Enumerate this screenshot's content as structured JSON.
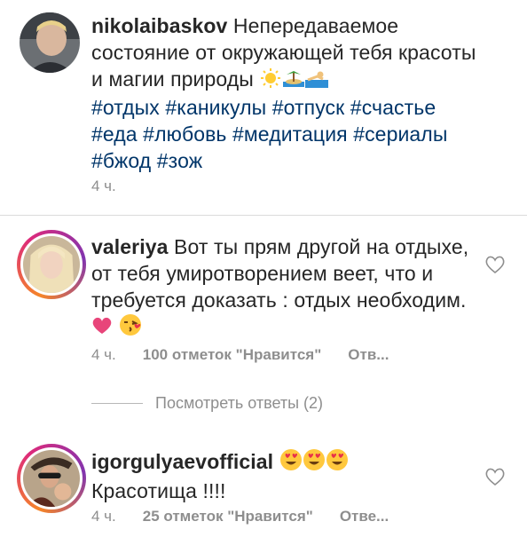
{
  "comments": [
    {
      "username": "nikolaibaskov",
      "text": "Непередаваемое состояние от окружающей тебя красоты и магии природы",
      "emoji_icons": [
        "sun-icon",
        "island-icon",
        "swimmer-icon"
      ],
      "hashtags": "#отдых #каникулы #отпуск  #счастье #еда #любовь #медитация #сериалы #бжод #зож",
      "time": "4 ч."
    },
    {
      "username": "valeriya",
      "text": "Вот ты прям другой на отдыхе, от тебя умиротворением веет, что и требуется доказать : отдых необходим.",
      "emoji_icons": [
        "heart-icon",
        "kissing-face-icon"
      ],
      "time": "4 ч.",
      "likes": "100 отметок \"Нравится\"",
      "reply": "Отв..."
    },
    {
      "username": "igorgulyaevofficial",
      "emoji_icons": [
        "heart-eyes-icon",
        "heart-eyes-icon",
        "heart-eyes-icon"
      ],
      "text": "Красотища !!!!",
      "time": "4 ч.",
      "likes": "25 отметок \"Нравится\"",
      "reply": "Отве..."
    }
  ],
  "view_replies": "Посмотреть ответы (2)",
  "colors": {
    "hashtag": "#003569",
    "muted": "#8e8e8e",
    "divider": "#dbdbdb"
  }
}
